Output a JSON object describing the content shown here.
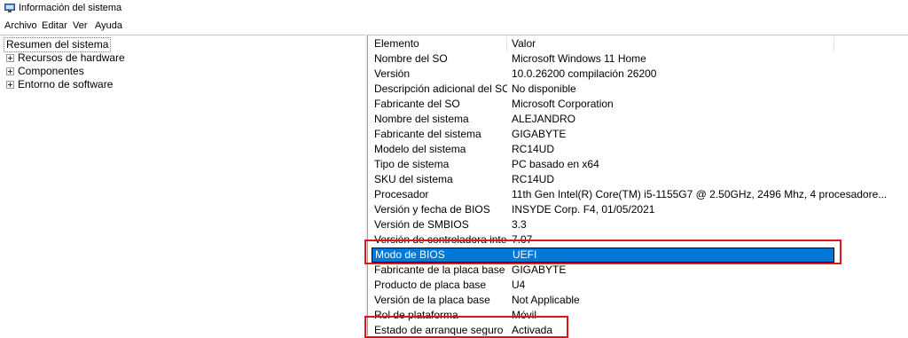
{
  "window": {
    "title": "Información del sistema"
  },
  "menu": [
    "Archivo",
    "Editar",
    "Ver",
    "Ayuda"
  ],
  "tree": {
    "root": "Resumen del sistema",
    "children": [
      "Recursos de hardware",
      "Componentes",
      "Entorno de software"
    ]
  },
  "table": {
    "headers": {
      "element": "Elemento",
      "value": "Valor"
    },
    "rows": [
      {
        "element": "Nombre del SO",
        "value": "Microsoft Windows 11 Home"
      },
      {
        "element": "Versión",
        "value": "10.0.26200 compilación 26200"
      },
      {
        "element": "Descripción adicional del SO",
        "value": "No disponible"
      },
      {
        "element": "Fabricante del SO",
        "value": "Microsoft Corporation"
      },
      {
        "element": "Nombre del sistema",
        "value": "ALEJANDRO"
      },
      {
        "element": "Fabricante del sistema",
        "value": "GIGABYTE"
      },
      {
        "element": "Modelo del sistema",
        "value": "RC14UD"
      },
      {
        "element": "Tipo de sistema",
        "value": "PC basado en x64"
      },
      {
        "element": "SKU del sistema",
        "value": "RC14UD"
      },
      {
        "element": "Procesador",
        "value": "11th Gen Intel(R) Core(TM) i5-1155G7 @ 2.50GHz, 2496 Mhz, 4 procesadore..."
      },
      {
        "element": "Versión y fecha de BIOS",
        "value": "INSYDE Corp. F4, 01/05/2021"
      },
      {
        "element": "Versión de SMBIOS",
        "value": "3.3"
      },
      {
        "element": "Versión de controladora integr...",
        "value": "7.07"
      },
      {
        "element": "Modo de BIOS",
        "value": "UEFI",
        "selected": true
      },
      {
        "element": "Fabricante de la placa base",
        "value": "GIGABYTE"
      },
      {
        "element": "Producto de placa base",
        "value": "U4"
      },
      {
        "element": "Versión de la placa base",
        "value": "Not Applicable"
      },
      {
        "element": "Rol de plataforma",
        "value": "Móvil"
      },
      {
        "element": "Estado de arranque seguro",
        "value": "Activada"
      }
    ]
  },
  "colors": {
    "selection": "#0078d7",
    "highlight": "#e0141b"
  }
}
